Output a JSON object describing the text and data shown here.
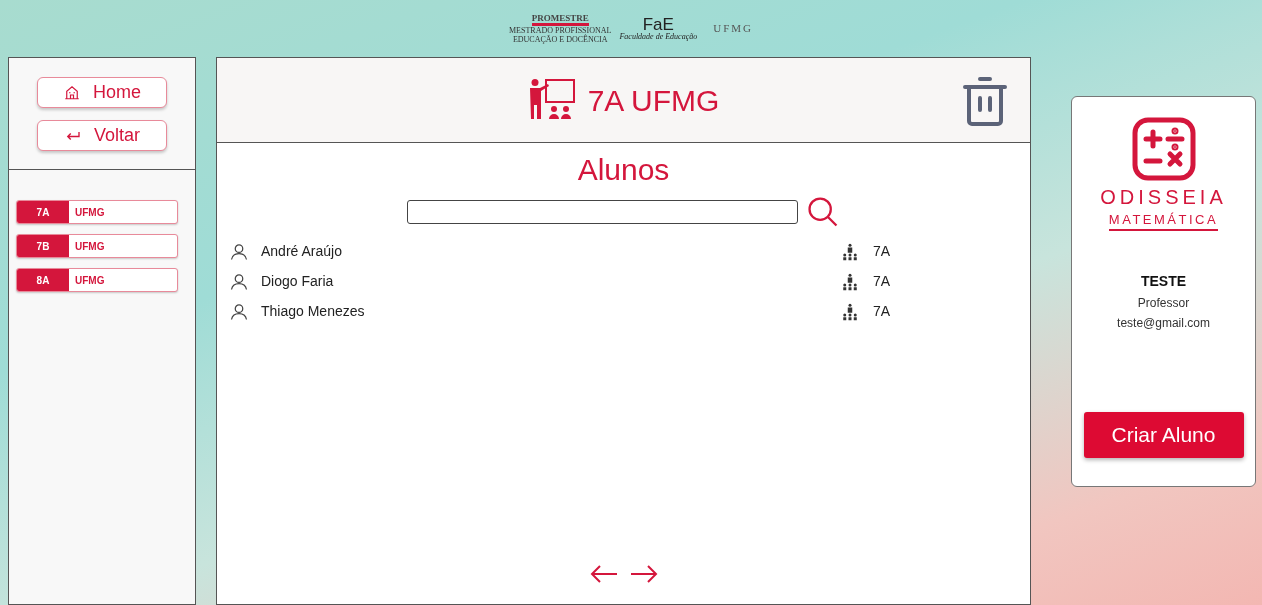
{
  "header_logos": {
    "promestre": {
      "title": "PROMESTRE",
      "subtitle": [
        "MESTRADO PROFISSIONAL",
        "EDUCAÇÃO E DOCÊNCIA"
      ]
    },
    "fae": {
      "title": "FaE",
      "subtitle": "Faculdade de Educação"
    },
    "ufmg": "UFMG"
  },
  "sidebar": {
    "buttons": [
      {
        "kind": "home",
        "label": "Home"
      },
      {
        "kind": "back",
        "label": "Voltar"
      }
    ],
    "classes": [
      {
        "code": "7A",
        "school": "UFMG"
      },
      {
        "code": "7B",
        "school": "UFMG"
      },
      {
        "code": "8A",
        "school": "UFMG"
      }
    ]
  },
  "class_panel": {
    "title": "7A UFMG",
    "section_title": "Alunos",
    "students": [
      {
        "name": "André Araújo",
        "class": "7A"
      },
      {
        "name": "Diogo Faria",
        "class": "7A"
      },
      {
        "name": "Thiago Menezes",
        "class": "7A"
      }
    ]
  },
  "profile": {
    "brand": [
      "ODISSEIA",
      "MATEMÁTICA"
    ],
    "name": "TESTE",
    "role": "Professor",
    "email": "teste@gmail.com",
    "button": "Criar Aluno"
  }
}
